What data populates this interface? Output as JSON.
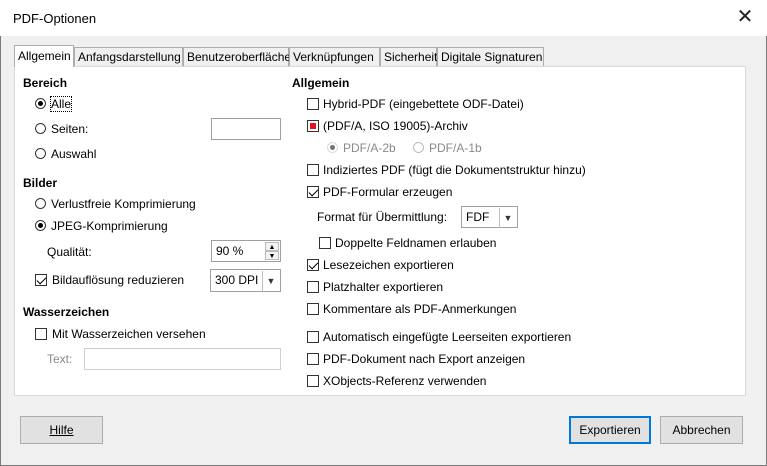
{
  "window": {
    "title": "PDF-Optionen",
    "close_glyph": "✕"
  },
  "tabs": [
    {
      "label": "Allgemein",
      "active": true
    },
    {
      "label": "Anfangsdarstellung"
    },
    {
      "label": "Benutzeroberfläche"
    },
    {
      "label": "Verknüpfungen"
    },
    {
      "label": "Sicherheit"
    },
    {
      "label": "Digitale Signaturen"
    }
  ],
  "left": {
    "bereich": {
      "title": "Bereich",
      "alle": "Alle",
      "seiten": "Seiten:",
      "seiten_value": "",
      "auswahl": "Auswahl"
    },
    "bilder": {
      "title": "Bilder",
      "verlustfrei": "Verlustfreie Komprimierung",
      "jpeg": "JPEG-Komprimierung",
      "qualitaet_label": "Qualität:",
      "qualitaet_value": "90 %",
      "aufloesung_label": "Bildauflösung reduzieren",
      "aufloesung_value": "300 DPI"
    },
    "wasserzeichen": {
      "title": "Wasserzeichen",
      "mit": "Mit Wasserzeichen versehen",
      "text_label": "Text:",
      "text_value": ""
    }
  },
  "right": {
    "title": "Allgemein",
    "hybrid": "Hybrid-PDF (eingebettete ODF-Datei)",
    "pdfa": "(PDF/A, ISO 19005)-Archiv",
    "pdfa2b": "PDF/A-2b",
    "pdfa1b": "PDF/A-1b",
    "indiziert": "Indiziertes PDF (fügt die Dokumentstruktur hinzu)",
    "formular": "PDF-Formular erzeugen",
    "format_label": "Format für Übermittlung:",
    "format_value": "FDF",
    "doppelte": "Doppelte Feldnamen erlauben",
    "lesezeichen": "Lesezeichen exportieren",
    "platzhalter": "Platzhalter exportieren",
    "kommentare": "Kommentare als PDF-Anmerkungen",
    "leerseiten": "Automatisch eingefügte Leerseiten exportieren",
    "anzeigen": "PDF-Dokument nach Export anzeigen",
    "xobjects": "XObjects-Referenz verwenden"
  },
  "buttons": {
    "hilfe": "Hilfe",
    "exportieren": "Exportieren",
    "abbrechen": "Abbrechen"
  },
  "colors": {
    "accent": "#0078d7",
    "archive_marker": "#e81123"
  }
}
